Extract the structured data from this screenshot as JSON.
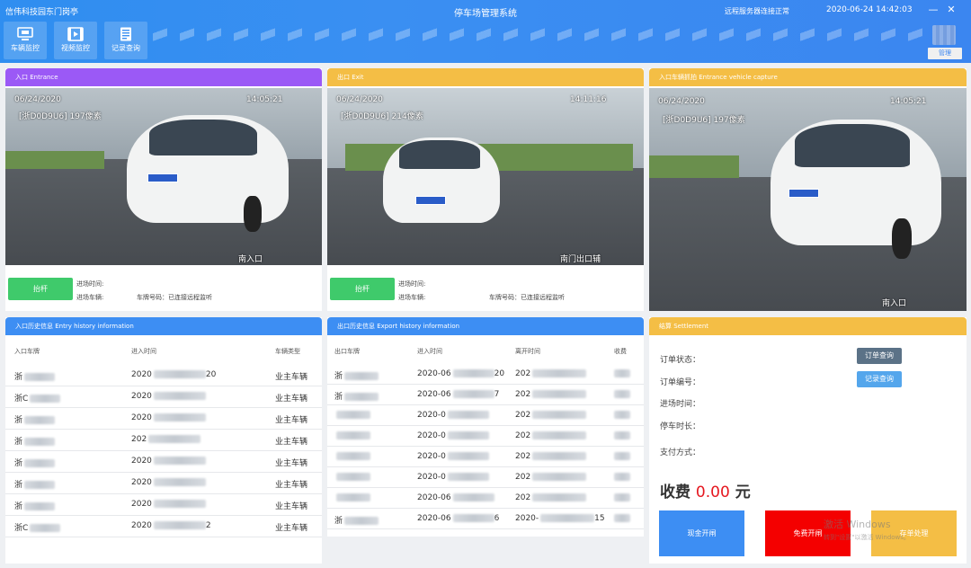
{
  "header": {
    "app_title": "信伟科技园东门岗亭",
    "system_title": "停车场管理系统",
    "server_status": "远程服务器连接正常",
    "datetime": "2020-06-24 14:42:03",
    "minimize": "—",
    "close": "✕",
    "admin_label": "管理"
  },
  "nav": [
    {
      "label": "车辆监控",
      "icon": "monitor-icon"
    },
    {
      "label": "视频监控",
      "icon": "video-icon"
    },
    {
      "label": "记录查询",
      "icon": "document-icon"
    }
  ],
  "entrance": {
    "title": "入口 Entrance",
    "cam_date": "06/24/2020",
    "cam_time": "14:05:21",
    "cam_plate": "[浙D0D9U6] 197像素",
    "cam_name": "南入口",
    "lift_label": "抬杆",
    "time_label": "进场时间:",
    "plate_label": "进场车辆:",
    "camera_status": "车牌号码：已连接远程监听"
  },
  "exit": {
    "title": "出口 Exit",
    "cam_date": "06/24/2020",
    "cam_time": "14:11:16",
    "cam_plate": "[浙D0D9U6] 214像素",
    "cam_name": "南门出口辅",
    "lift_label": "抬杆",
    "time_label": "进场时间:",
    "plate_label": "进场车辆:",
    "camera_status": "车牌号码：已连接远程监听"
  },
  "capture": {
    "title": "入口车辆抓拍 Entrance vehicle capture",
    "cam_date": "06/24/2020",
    "cam_time": "14:05:21",
    "cam_plate": "[浙D0D9U6] 197像素",
    "cam_name": "南入口"
  },
  "entry_history": {
    "title": "入口历史信息 Entry history information",
    "columns": [
      "入口车牌",
      "进入时间",
      "车辆类型"
    ],
    "rows": [
      {
        "plate": "浙",
        "time_start": "2020",
        "time_end": "20",
        "type": "业主车辆"
      },
      {
        "plate": "浙C",
        "time_start": "2020",
        "time_end": "",
        "type": "业主车辆"
      },
      {
        "plate": "浙",
        "time_start": "2020",
        "time_end": "",
        "type": "业主车辆"
      },
      {
        "plate": "浙",
        "time_start": "202",
        "time_end": "",
        "type": "业主车辆"
      },
      {
        "plate": "浙",
        "time_start": "2020",
        "time_end": "",
        "type": "业主车辆"
      },
      {
        "plate": "浙",
        "time_start": "2020",
        "time_end": "",
        "type": "业主车辆"
      },
      {
        "plate": "浙",
        "time_start": "2020",
        "time_end": "",
        "type": "业主车辆"
      },
      {
        "plate": "浙C",
        "time_start": "2020",
        "time_end": "2",
        "type": "业主车辆"
      }
    ]
  },
  "exit_history": {
    "title": "出口历史信息 Export history information",
    "columns": [
      "出口车牌",
      "进入时间",
      "离开时间",
      "收费"
    ],
    "rows": [
      {
        "plate": "浙",
        "in_start": "2020-06",
        "in_end": "20",
        "out_start": "202",
        "out_end": ""
      },
      {
        "plate": "浙",
        "in_start": "2020-06",
        "in_end": "7",
        "out_start": "202",
        "out_end": ""
      },
      {
        "plate": "",
        "in_start": "2020-0",
        "in_end": "",
        "out_start": "202",
        "out_end": ""
      },
      {
        "plate": "",
        "in_start": "2020-0",
        "in_end": "",
        "out_start": "202",
        "out_end": ""
      },
      {
        "plate": "",
        "in_start": "2020-0",
        "in_end": "",
        "out_start": "202",
        "out_end": ""
      },
      {
        "plate": "",
        "in_start": "2020-0",
        "in_end": "",
        "out_start": "202",
        "out_end": ""
      },
      {
        "plate": "",
        "in_start": "2020-06",
        "in_end": "",
        "out_start": "202",
        "out_end": ""
      },
      {
        "plate": "浙",
        "in_start": "2020-06",
        "in_end": "6",
        "out_start": "2020-",
        "out_end": "15"
      }
    ]
  },
  "settlement": {
    "title": "结算 Settlement",
    "order_status_label": "订单状态：",
    "order_number_label": "订单编号：",
    "entry_time_label": "进场时间：",
    "duration_label": "停车时长：",
    "payment_label": "支付方式：",
    "order_query_btn": "订单查询",
    "record_query_btn": "记录查询",
    "fee_label": "收费",
    "fee_amount": "0.00",
    "fee_unit": "元",
    "cash_btn": "现金开闸",
    "free_btn": "免费开闸",
    "store_btn": "存单处理"
  },
  "watermark": {
    "line1": "激活 Windows",
    "line2": "转到\"设置\"以激活 Windows。"
  }
}
